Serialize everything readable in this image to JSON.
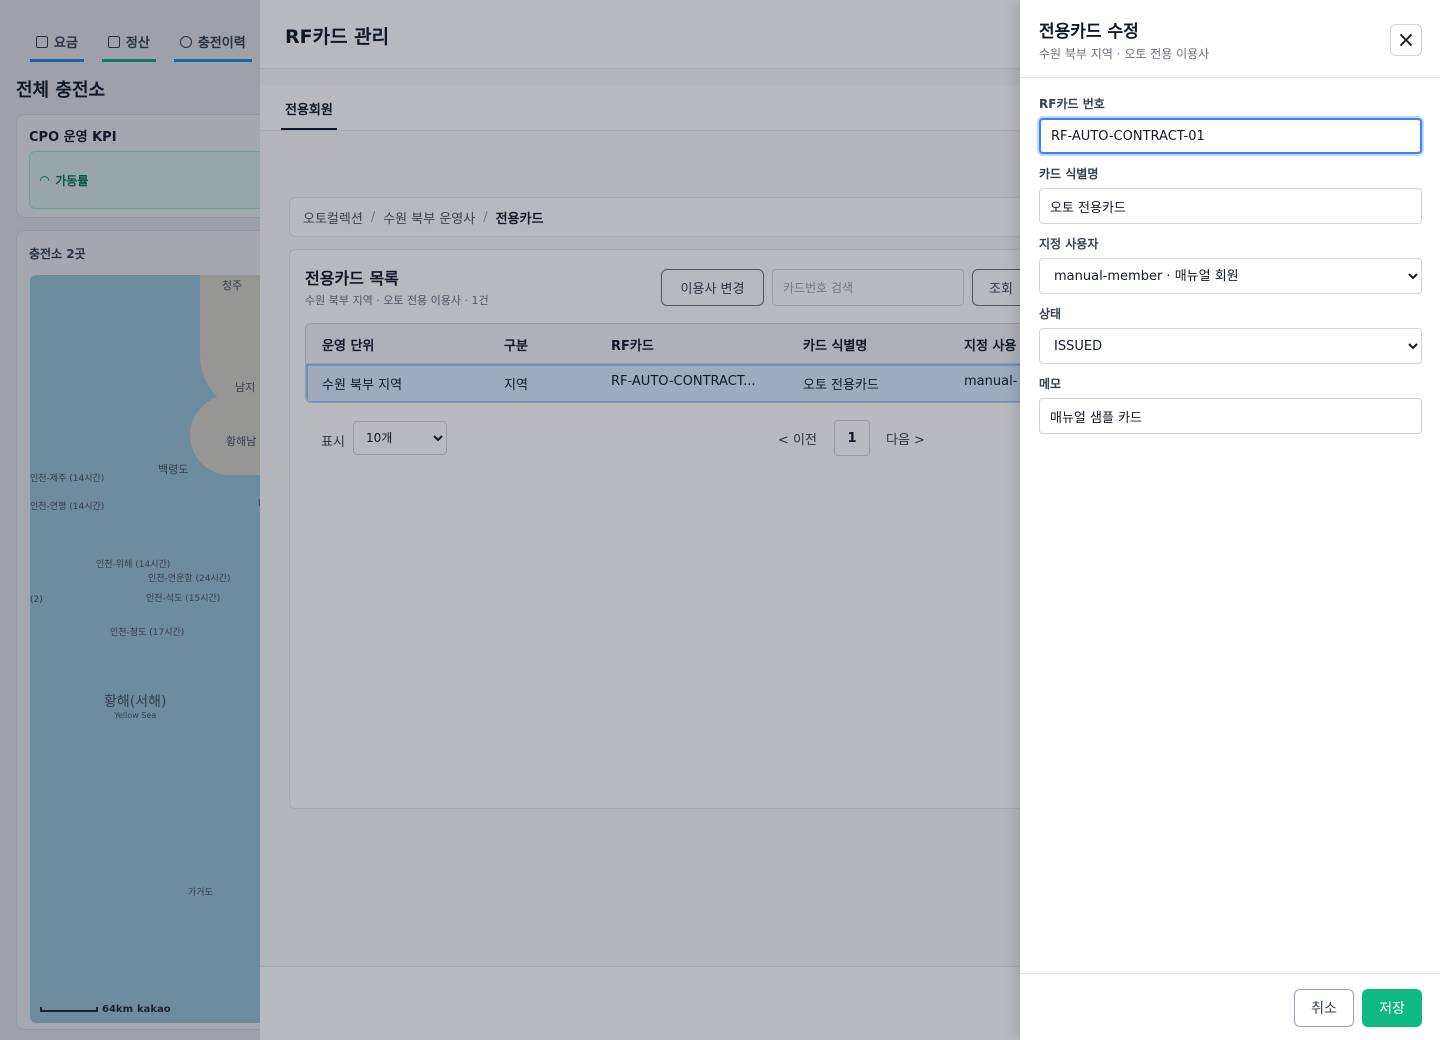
{
  "background": {
    "tabs": [
      {
        "label": "요금"
      },
      {
        "label": "정산"
      },
      {
        "label": "충전이력"
      }
    ],
    "page_title": "전체 충전소",
    "kpi": {
      "title": "CPO 운영 KPI",
      "metric_label": "가동률"
    },
    "map_card": {
      "title": "충전소 2곳"
    },
    "map": {
      "labels": [
        "청주",
        "남지",
        "황해남",
        "백령도",
        "대",
        "인천-제주 (14시간)",
        "인천-연평 (14시간)",
        "인천-위해 (14시간)",
        "인천-연운항 (24시간)",
        "인천-석도 (15시간)",
        "인천-청도 (17시간)",
        "가거도",
        "(2)"
      ],
      "sea_name": "황해(서해)",
      "sea_name_en": "Yellow Sea",
      "scale": "64km",
      "brand": "kakao"
    }
  },
  "modal": {
    "title": "RF카드 관리",
    "tab": "전용회원",
    "breadcrumb": [
      "오토컬렉션",
      "수원 북부 운영사",
      "전용카드"
    ],
    "list": {
      "title": "전용카드 목록",
      "subtitle": "수원 북부 지역 · 오토 전용 이용사 · 1건",
      "change_button": "이용사 변경",
      "search_placeholder": "카드번호 검색",
      "query_button": "조회",
      "columns": [
        "운영 단위",
        "구분",
        "RF카드",
        "카드 식별명",
        "지정 사용"
      ],
      "rows": [
        {
          "unit": "수원 북부 지역",
          "type": "지역",
          "rfcard": "RF-AUTO-CONTRACT...",
          "card_name": "오토 전용카드",
          "assigned": "manual-"
        }
      ]
    },
    "pagination": {
      "display_label": "표시",
      "page_size": "10개",
      "prev": "< 이전",
      "current_page": "1",
      "next": "다음 >"
    }
  },
  "drawer": {
    "title": "전용카드 수정",
    "subtitle": "수원 북부 지역 · 오토 전용 이용사",
    "close_icon": "close-icon",
    "fields": {
      "rfcard_label": "RF카드 번호",
      "rfcard_value": "RF-AUTO-CONTRACT-01",
      "card_name_label": "카드 식별명",
      "card_name_value": "오토 전용카드",
      "assignee_label": "지정 사용자",
      "assignee_value": "manual-member · 매뉴얼 회원",
      "status_label": "상태",
      "status_value": "ISSUED",
      "memo_label": "메모",
      "memo_value": "매뉴얼 샘플 카드"
    },
    "cancel_label": "취소",
    "save_label": "저장"
  },
  "colors": {
    "accent_green": "#10b981",
    "focus_blue": "#3b82f6",
    "selected_row": "#dbeafe"
  }
}
